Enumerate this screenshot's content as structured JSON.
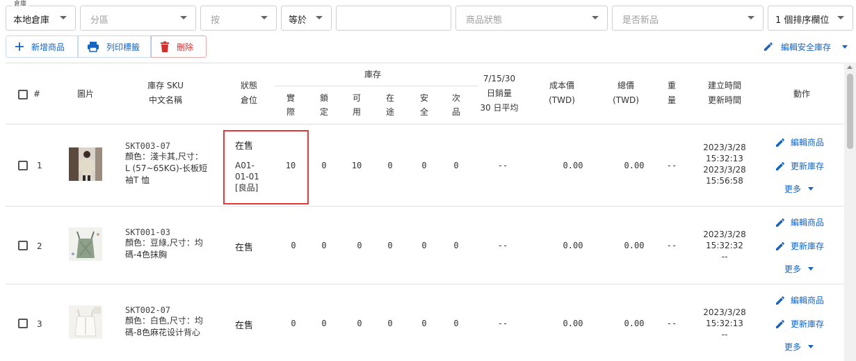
{
  "filters": {
    "warehouse": {
      "legend": "倉庫",
      "value": "本地倉庫"
    },
    "zone": {
      "placeholder": "分區"
    },
    "field": {
      "placeholder": "按"
    },
    "operator": {
      "value": "等於"
    },
    "keyword": {
      "value": ""
    },
    "product_status": {
      "placeholder": "商品狀態"
    },
    "is_new": {
      "placeholder": "是否新品"
    },
    "sort": {
      "value": "1 個排序欄位"
    }
  },
  "toolbar": {
    "add_label": "新增商品",
    "print_label": "列印標籤",
    "delete_label": "刪除",
    "safety_stock_label": "編輯安全庫存"
  },
  "table": {
    "headers": {
      "index": "#",
      "image": "圖片",
      "sku_line1": "庫存 SKU",
      "sku_line2": "中文名稱",
      "status_line1": "狀態",
      "status_line2": "倉位",
      "stock_group": "庫存",
      "stock_cols": [
        [
          "實",
          "際"
        ],
        [
          "鎖",
          "定"
        ],
        [
          "可",
          "用"
        ],
        [
          "在",
          "途"
        ],
        [
          "安",
          "全"
        ],
        [
          "次",
          "品"
        ]
      ],
      "sales_line1": "7/15/30",
      "sales_line2": "日銷量",
      "sales_line3": "30 日平均",
      "cost_line1": "成本價",
      "cost_line2": "(TWD)",
      "total_line1": "總價",
      "total_line2": "(TWD)",
      "weight_line1": "重",
      "weight_line2": "量",
      "time_line1": "建立時間",
      "time_line2": "更新時間",
      "actions": "動作"
    },
    "rows": [
      {
        "index": "1",
        "sku": "SKT003-07",
        "name": "顏色：淺卡其,尺寸：L (57~65KG)-长板短袖T 恤",
        "status": "在售",
        "location": "A01-01-01",
        "location_line1": "A01-",
        "location_line2": "01-01",
        "grade": "[良品]",
        "stock": [
          "10",
          "0",
          "10",
          "0",
          "0",
          "0"
        ],
        "sales": "--",
        "cost": "0.00",
        "total": "0.00",
        "weight": "--",
        "created_date": "2023/3/28",
        "created_time": "15:32:13",
        "updated_date": "2023/3/28",
        "updated_time": "15:56:58",
        "edit_label": "編輯商品",
        "update_stock_label": "更新庫存",
        "more_label": "更多"
      },
      {
        "index": "2",
        "sku": "SKT001-03",
        "name": "顏色：豆綠,尺寸：均碼-4色抹胸",
        "status": "在售",
        "stock": [
          "0",
          "0",
          "0",
          "0",
          "0",
          "0"
        ],
        "sales": "--",
        "cost": "0.00",
        "total": "0.00",
        "weight": "--",
        "created_date": "2023/3/28",
        "created_time": "15:32:32",
        "updated": "--",
        "edit_label": "編輯商品",
        "update_stock_label": "更新庫存",
        "more_label": "更多"
      },
      {
        "index": "3",
        "sku": "SKT002-07",
        "name": "顏色：白色,尺寸：均碼-8色麻花设计背心",
        "status": "在售",
        "stock": [
          "0",
          "0",
          "0",
          "0",
          "0",
          "0"
        ],
        "sales": "--",
        "cost": "0.00",
        "total": "0.00",
        "weight": "--",
        "created_date": "2023/3/28",
        "created_time": "15:32:13",
        "updated": "--",
        "edit_label": "編輯商品",
        "update_stock_label": "更新庫存",
        "more_label": "更多"
      }
    ]
  },
  "colors": {
    "accent": "#1565c0",
    "danger": "#d32f2f",
    "highlight": "#e53935",
    "border": "#e0e0e0"
  },
  "icons": {
    "add": "plus-icon",
    "print": "printer-icon",
    "delete": "trash-icon",
    "edit": "pencil-icon",
    "more": "chevron-down-icon"
  }
}
